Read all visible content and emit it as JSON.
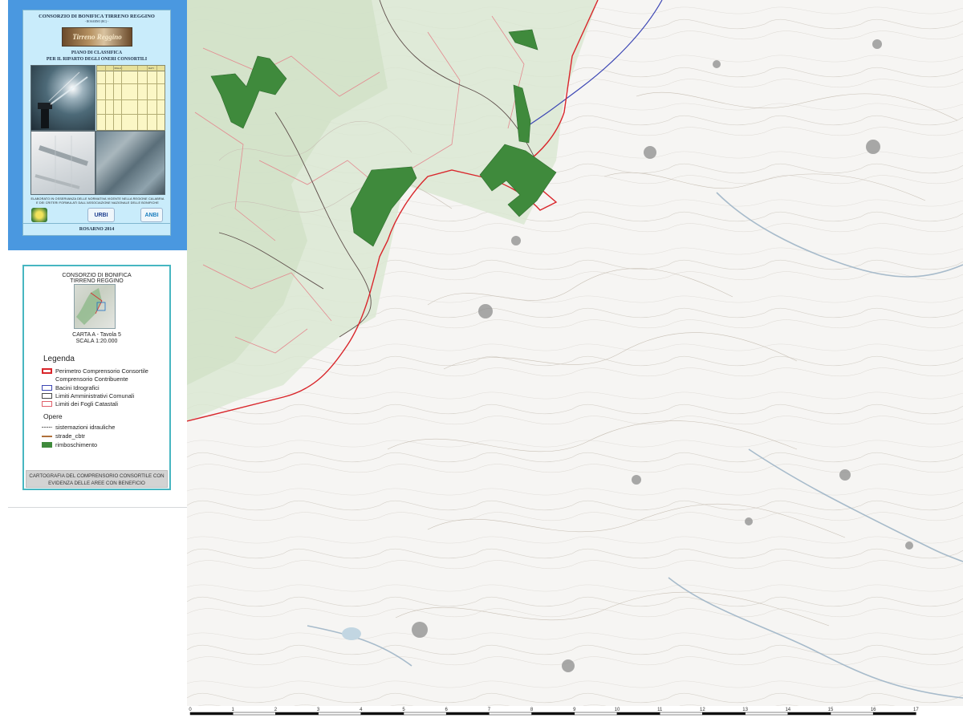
{
  "cover": {
    "title": "CONSORZIO DI BONIFICA TIRRENO REGGINO",
    "subtitle": "- ROSARNO (RC) -",
    "logo_text": "Tirreno Reggino",
    "plan_line1": "PIANO DI CLASSIFICA",
    "plan_line2": "PER IL RIPARTO DEGLI ONERI CONSORTILI",
    "table_header_left": "FOGLIO",
    "table_header_right": "DATI",
    "note_line1": "ELABORATO IN OSSERVANZA DELLE NORMATIVA VIGENTE NELLA REGIONE CALABRIA",
    "note_line2": "E DEI CRITERI FORMULATI DALL'ASSOCIAZIONE NAZIONALE DELLE BONIFICHE",
    "badge_middle": "URBI",
    "badge_right": "ANBI",
    "footer": "ROSARNO 2014"
  },
  "info": {
    "org_line1": "CONSORZIO DI BONIFICA",
    "org_line2": "TIRRENO REGGINO",
    "sheet": "CARTA A - Tavola 5",
    "scale": "SCALA 1:20.000",
    "legend_title": "Legenda",
    "legend": [
      {
        "label": "Perimetro Comprensorio Consortile",
        "color": "#d9262b"
      },
      {
        "label": "Comprensorio Contribuente",
        "color": ""
      },
      {
        "label": "Bacini Idrografici",
        "color": "#3c46b4"
      },
      {
        "label": "Limiti Amministrativi Comunali",
        "color": "#4a4a4a"
      },
      {
        "label": "Limiti dei Fogli Catastali",
        "color": "#e0606a"
      }
    ],
    "opere_title": "Opere",
    "opere": [
      {
        "label": "sistemazioni idrauliche",
        "color": "#7a7a7a"
      },
      {
        "label": "strade_cbtr",
        "color": "#b0703a"
      },
      {
        "label": "rimboschimento",
        "color": "#3f8a3c"
      }
    ],
    "caption_line1": "CARTOGRAFIA DEL COMPRENSORIO CONSORTILE CON",
    "caption_line2": "EVIDENZA DELLE AREE CON BENEFICIO"
  },
  "colors": {
    "sidebar_blue": "#4a98e0",
    "cover_bg": "#c9ecfb",
    "frame_teal": "#47b6c1",
    "forest": "#3f8a3c",
    "perimeter": "#d9262b",
    "river": "#3c46b4"
  },
  "scale_ticks": [
    "0",
    "1",
    "2",
    "3",
    "4",
    "5",
    "6",
    "7",
    "8",
    "9",
    "10",
    "11",
    "12",
    "13",
    "14",
    "15",
    "16",
    "17"
  ]
}
